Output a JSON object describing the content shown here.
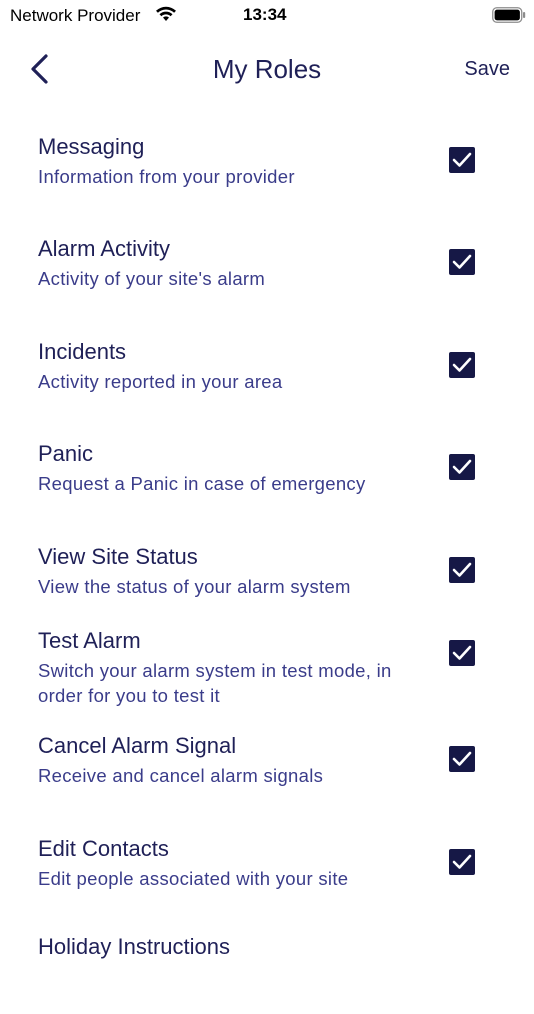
{
  "status_bar": {
    "carrier": "Network Provider",
    "time": "13:34",
    "wifi_icon": "wifi-icon",
    "battery_icon": "battery-icon"
  },
  "nav": {
    "back_icon": "chevron-left-icon",
    "title": "My Roles",
    "save_label": "Save"
  },
  "roles": [
    {
      "title": "Messaging",
      "description": "Information from your provider",
      "checked": true
    },
    {
      "title": "Alarm Activity",
      "description": "Activity of your site's alarm",
      "checked": true
    },
    {
      "title": "Incidents",
      "description": "Activity reported in your area",
      "checked": true
    },
    {
      "title": "Panic",
      "description": "Request a Panic in case of emergency",
      "checked": true
    },
    {
      "title": "View Site Status",
      "description": "View the status of your alarm system",
      "checked": true
    },
    {
      "title": "Test Alarm",
      "description": "Switch your alarm system in test mode, in order for you to test it",
      "checked": true
    },
    {
      "title": "Cancel Alarm Signal",
      "description": "Receive and cancel alarm signals",
      "checked": true
    },
    {
      "title": "Edit Contacts",
      "description": "Edit people associated with your site",
      "checked": true
    },
    {
      "title": "Holiday Instructions",
      "description": "",
      "checked": true
    }
  ],
  "colors": {
    "accent": "#1f2057",
    "description": "#3a3c8a",
    "checkbox_fill": "#161846"
  }
}
